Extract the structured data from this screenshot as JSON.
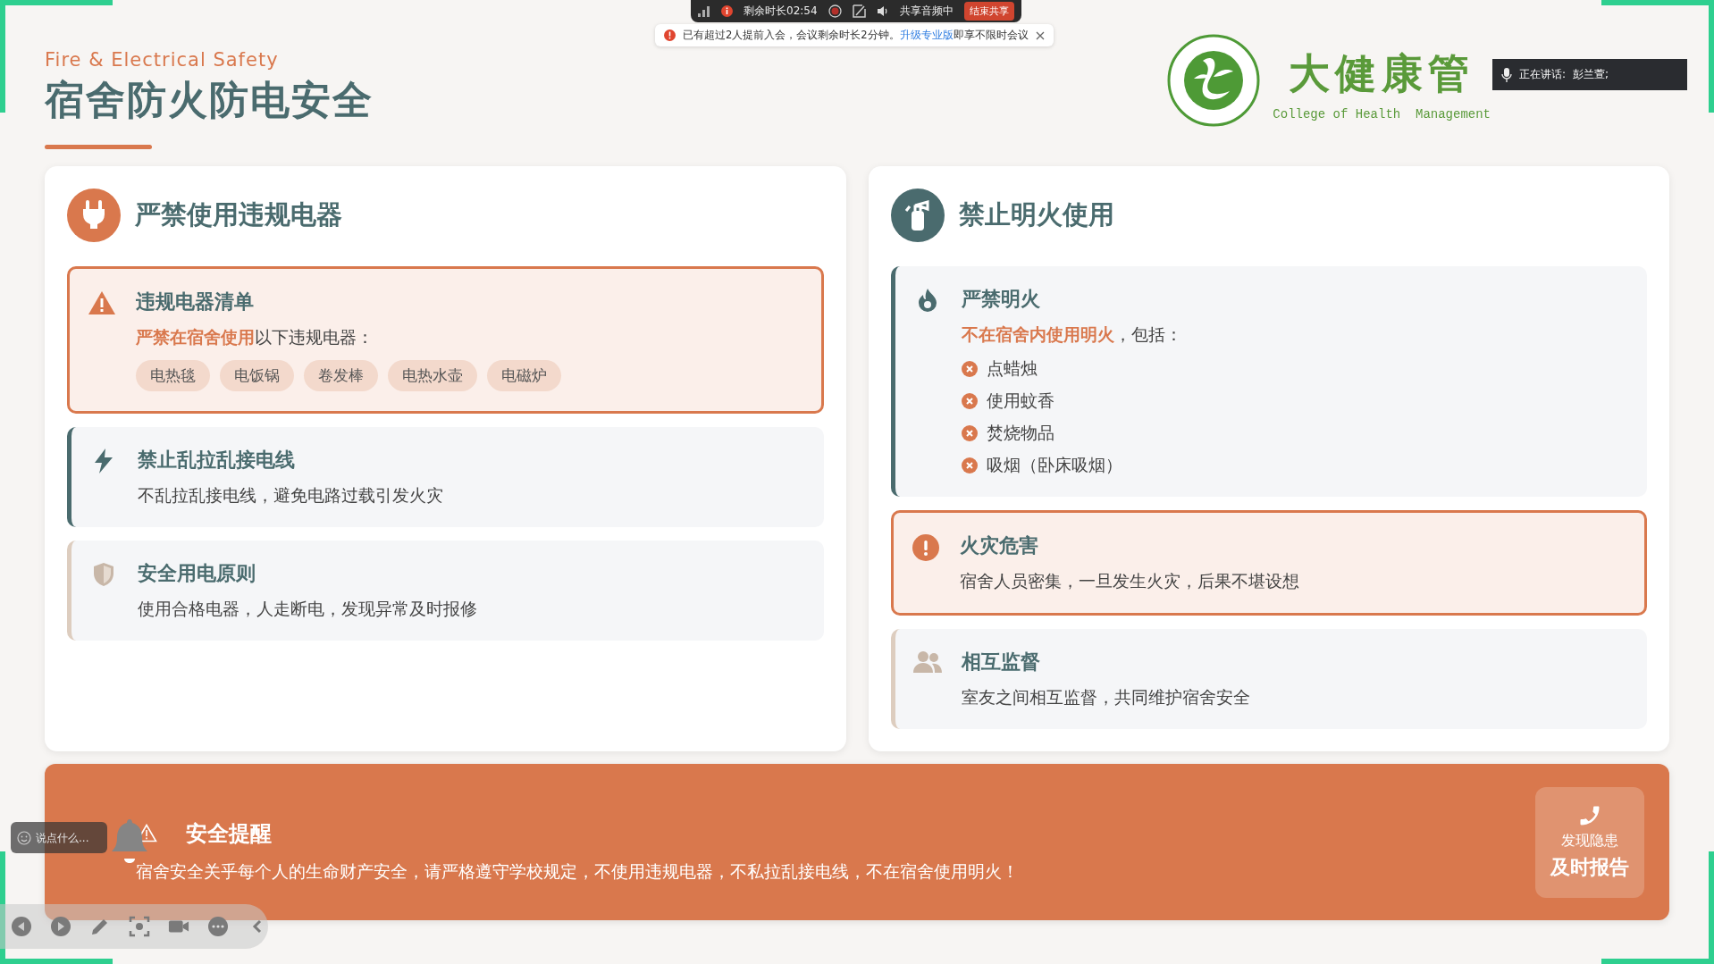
{
  "meeting_bar": {
    "remaining": "剩余时长02:54",
    "audio": "共享音频中",
    "end_button": "结束共享"
  },
  "notice": {
    "text": "已有超过2人提前入会，会议剩余时长2分钟。",
    "link": "升级专业版",
    "text_after": "即享不限时会议"
  },
  "header": {
    "subtitle": "Fire & Electrical Safety",
    "title": "宿舍防火防电安全"
  },
  "logo": {
    "name": "大健康管",
    "english": "College of Health  Management"
  },
  "speaking": {
    "label": "正在讲话:",
    "name": "彭兰萱;"
  },
  "panels": [
    {
      "title": "严禁使用违规电器",
      "items": [
        {
          "kind": "alert",
          "color": "#d9784d",
          "title": "违规电器清单",
          "text": "**严禁在宿舍使用**以下违规电器：",
          "tags": [
            "电热毯",
            "电饭锅",
            "卷发棒",
            "电热水壶",
            "电磁炉"
          ]
        },
        {
          "kind": "note",
          "color": "#4a6b6e",
          "title": "禁止乱拉乱接电线",
          "text": "不乱拉乱接电线，避免电路过载引发火灾"
        },
        {
          "kind": "note",
          "color": "#ddcdbf",
          "title": "安全用电原则",
          "text": "使用合格电器，人走断电，发现异常及时报修"
        }
      ]
    },
    {
      "title": "禁止明火使用",
      "items": [
        {
          "kind": "note",
          "color": "#4a6b6e",
          "title": "严禁明火",
          "text": "**不在宿舍内使用明火**，包括：",
          "bullets": [
            "点蜡烛",
            "使用蚊香",
            "焚烧物品",
            "吸烟（卧床吸烟）"
          ]
        },
        {
          "kind": "alert",
          "color": "#d9784d",
          "title": "火灾危害",
          "text": "宿舍人员密集，一旦发生火灾，后果不堪设想"
        },
        {
          "kind": "note",
          "color": "#ddcdbf",
          "title": "相互监督",
          "text": "室友之间相互监督，共同维护宿舍安全"
        }
      ]
    }
  ],
  "banner": {
    "title": "安全提醒",
    "text": "宿舍安全关乎每个人的生命财产安全，请严格遵守学校规定，不使用违规电器，不私拉乱接电线，不在宿舍使用明火！",
    "action_line1": "发现隐患",
    "action_line2": "及时报告"
  },
  "chat": {
    "placeholder": "说点什么..."
  }
}
